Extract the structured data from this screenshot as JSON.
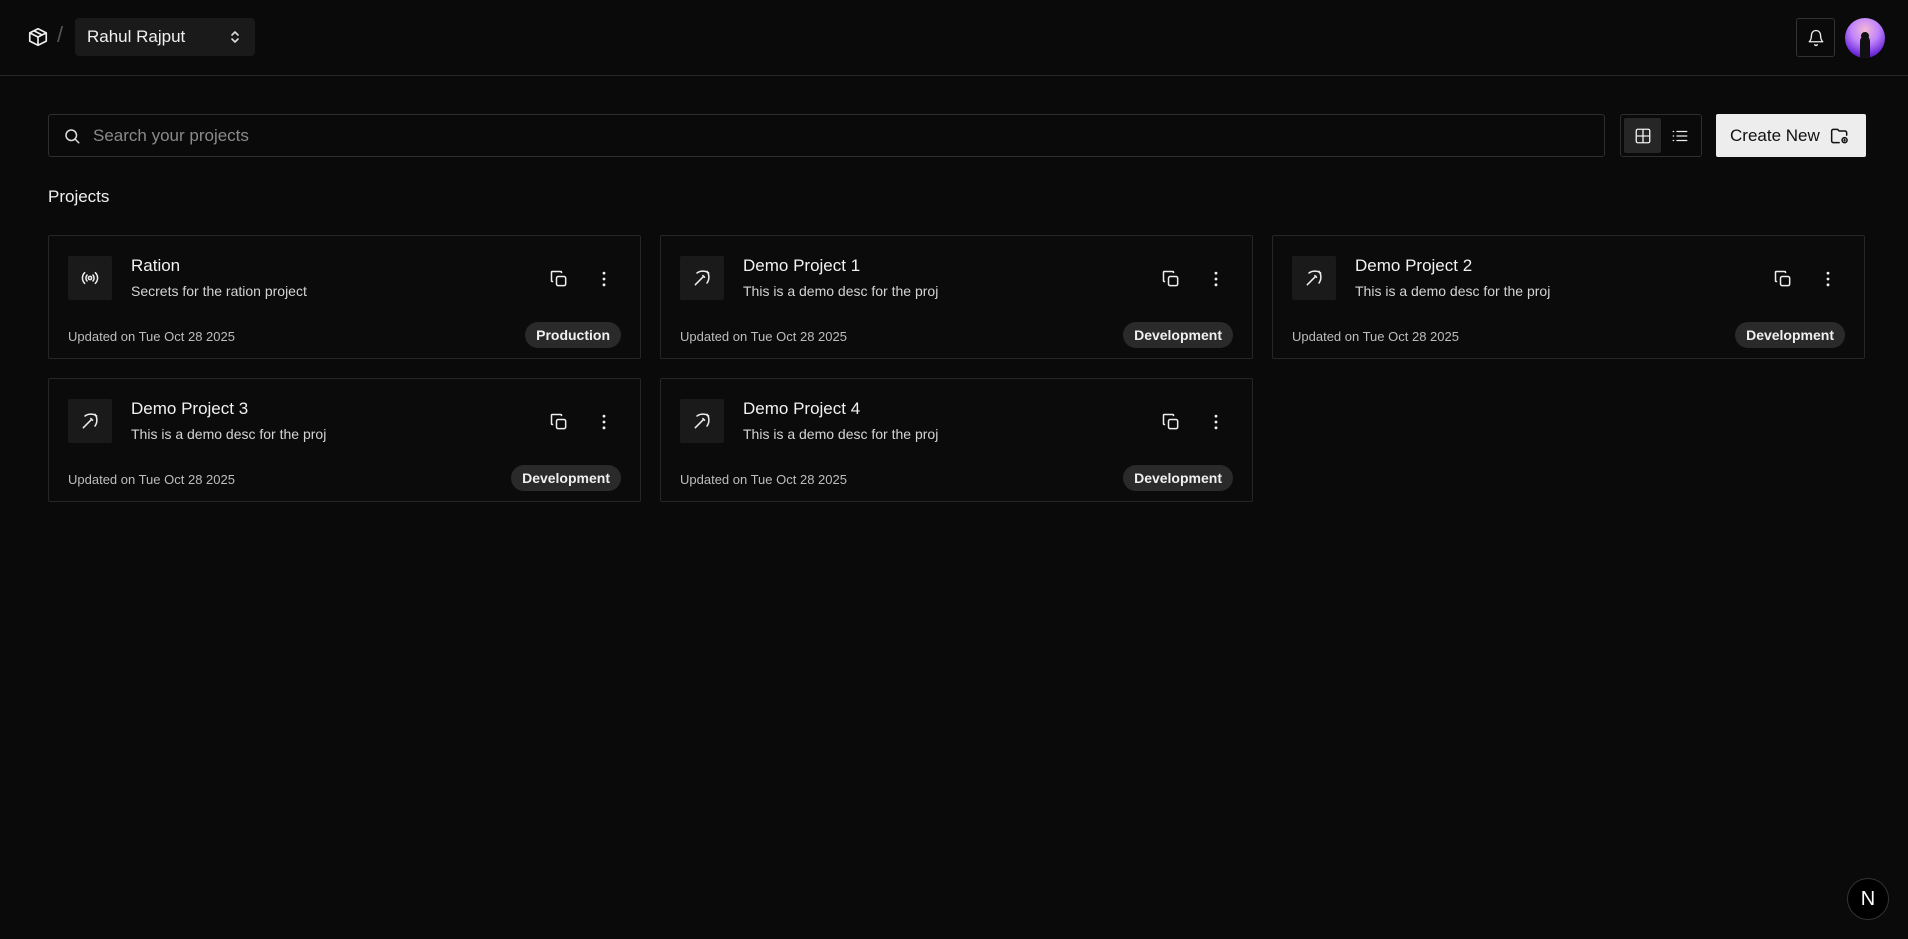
{
  "header": {
    "logo_icon": "package-icon",
    "separator": "/",
    "org_name": "Rahul Rajput",
    "org_switch_icon": "chevrons-up-down-icon",
    "notification_icon": "bell-icon",
    "avatar_icon": "user-avatar"
  },
  "toolbar": {
    "search_placeholder": "Search your projects",
    "search_value": "",
    "search_icon": "search-icon",
    "grid_view_icon": "grid-icon",
    "list_view_icon": "list-icon",
    "active_view": "grid",
    "create_label": "Create New",
    "create_icon": "folder-plus-icon"
  },
  "projects": {
    "section_title": "Projects",
    "items": [
      {
        "title": "Ration",
        "description": "Secrets for the ration project",
        "updated": "Updated on Tue Oct 28 2025",
        "environment": "Production",
        "icon": "broadcast-icon"
      },
      {
        "title": "Demo Project 1",
        "description": "This is a demo desc for the proj",
        "updated": "Updated on Tue Oct 28 2025",
        "environment": "Development",
        "icon": "pickaxe-icon"
      },
      {
        "title": "Demo Project 2",
        "description": "This is a demo desc for the proj",
        "updated": "Updated on Tue Oct 28 2025",
        "environment": "Development",
        "icon": "pickaxe-icon"
      },
      {
        "title": "Demo Project 3",
        "description": "This is a demo desc for the proj",
        "updated": "Updated on Tue Oct 28 2025",
        "environment": "Development",
        "icon": "pickaxe-icon"
      },
      {
        "title": "Demo Project 4",
        "description": "This is a demo desc for the proj",
        "updated": "Updated on Tue Oct 28 2025",
        "environment": "Development",
        "icon": "pickaxe-icon"
      }
    ]
  },
  "dev_indicator": {
    "label": "N"
  },
  "colors": {
    "background": "#0a0a0a",
    "border": "#262626",
    "badge_bg": "#2a2a2a",
    "button_light": "#ededed"
  }
}
